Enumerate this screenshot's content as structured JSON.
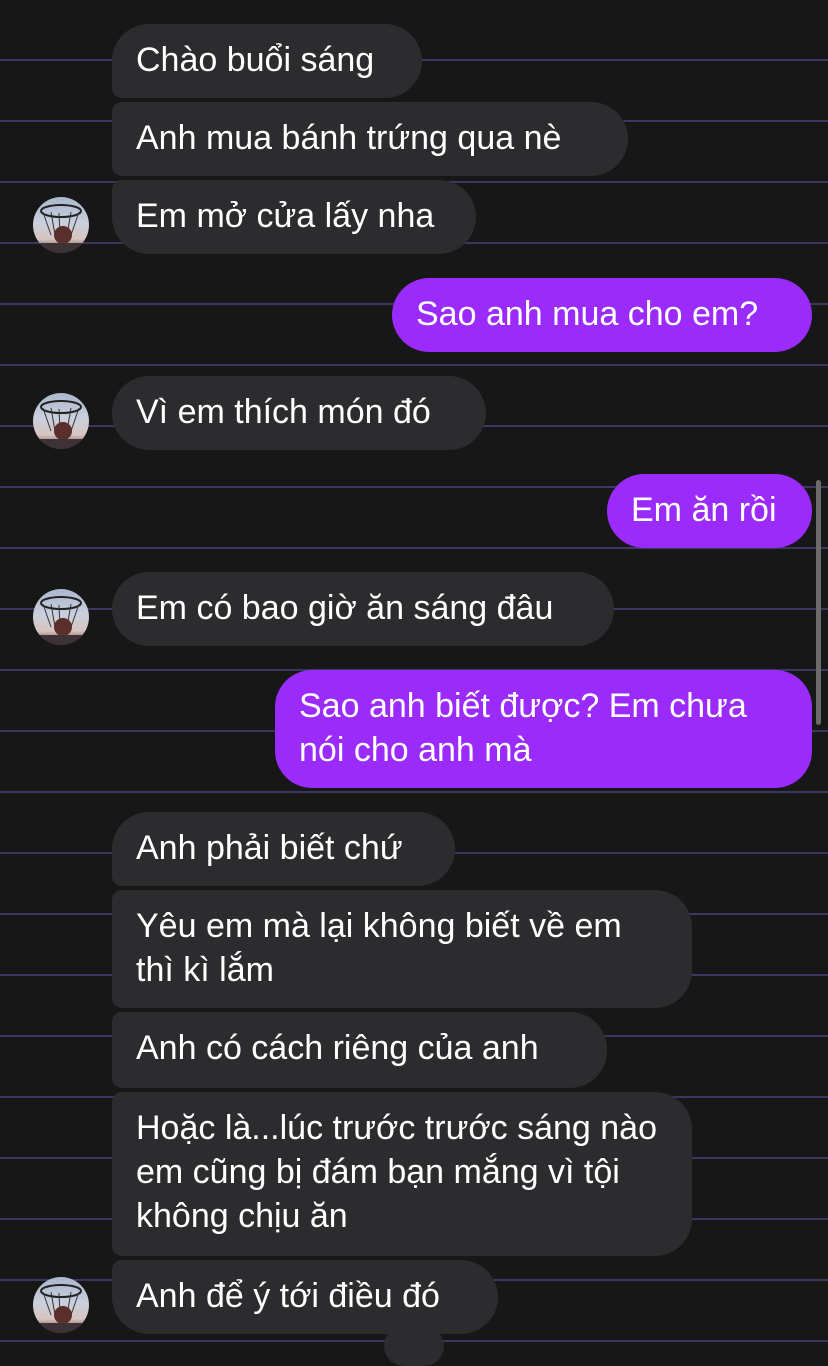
{
  "chat": {
    "messages": [
      {
        "side": "in",
        "text": "Chào buổi sáng",
        "avatar": false
      },
      {
        "side": "in",
        "text": "Anh mua bánh trứng qua nè",
        "avatar": false
      },
      {
        "side": "in",
        "text": "Em mở cửa lấy nha",
        "avatar": true
      },
      {
        "side": "out",
        "text": "Sao anh mua cho em?"
      },
      {
        "side": "in",
        "text": "Vì em thích món đó",
        "avatar": true
      },
      {
        "side": "out",
        "text": "Em ăn rồi"
      },
      {
        "side": "in",
        "text": "Em có bao giờ ăn sáng đâu",
        "avatar": true
      },
      {
        "side": "out",
        "text": "Sao anh biết được? Em chưa nói cho anh mà"
      },
      {
        "side": "in",
        "text": "Anh phải biết chứ",
        "avatar": false
      },
      {
        "side": "in",
        "text": "Yêu em mà lại không biết về em thì kì lắm",
        "avatar": false
      },
      {
        "side": "in",
        "text": "Anh có cách riêng của anh",
        "avatar": false
      },
      {
        "side": "in",
        "text": "Hoặc là...lúc trước trước sáng nào em cũng bị đám bạn mắng vì tội không chịu ăn",
        "avatar": false
      },
      {
        "side": "in",
        "text": "Anh để ý tới điều đó",
        "avatar": true
      }
    ]
  },
  "colors": {
    "background": "#171717",
    "incoming_bubble": "#2c2c2e",
    "outgoing_bubble": "#9a2bfa",
    "text": "#ffffff"
  },
  "icons": {
    "avatar": "basketball-hoop-avatar-icon"
  }
}
